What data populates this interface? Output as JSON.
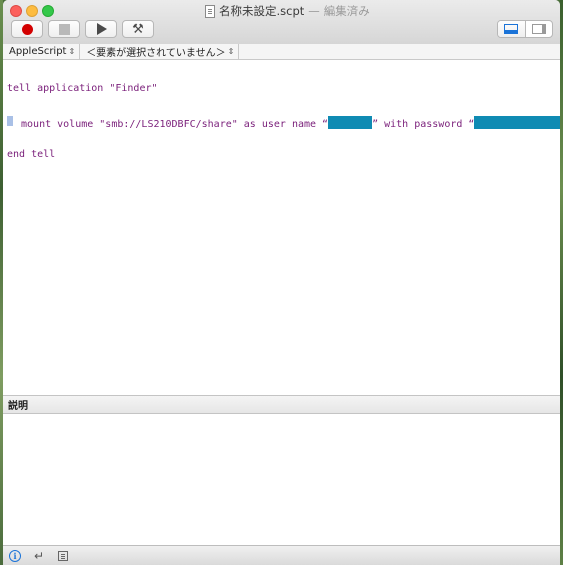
{
  "window": {
    "title": "名称未設定.scpt",
    "title_separator": "—",
    "status": "編集済み"
  },
  "toolbar": {
    "buttons": [
      {
        "name": "record",
        "icon": "record-icon"
      },
      {
        "name": "stop",
        "icon": "stop-icon"
      },
      {
        "name": "run",
        "icon": "play-icon"
      },
      {
        "name": "compile",
        "icon": "hammer-icon"
      }
    ],
    "view_toggle": {
      "active": "bottom-pane",
      "options": [
        "bottom-pane-icon",
        "side-pane-icon"
      ]
    }
  },
  "navbar": {
    "language": "AppleScript",
    "handler": "＜要素が選択されていません＞"
  },
  "editor": {
    "line1": "tell application \"Finder\"",
    "line2_prefix": " mount volume \"smb://LS210DBFC/share\" as user name “",
    "line2_middle": "” with password “",
    "line2_suffix": "”",
    "line3": "end tell"
  },
  "description_pane": {
    "label": "説明"
  },
  "bottom_bar": {
    "icons": [
      "info-icon",
      "return-icon",
      "list-icon"
    ]
  },
  "colors": {
    "code_text": "#7a1f7a",
    "redaction": "#0f8bb3",
    "accent": "#1a73d8",
    "record": "#d30000"
  }
}
